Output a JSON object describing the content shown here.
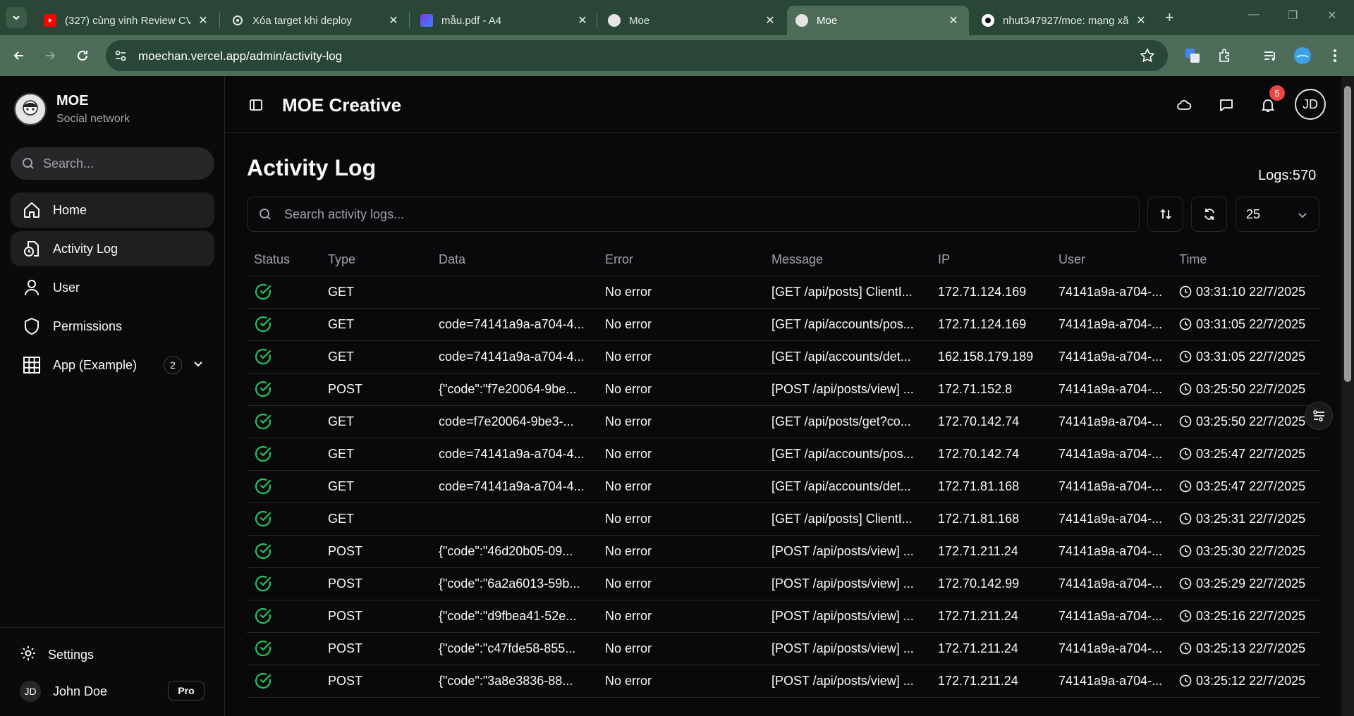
{
  "browser": {
    "tabs": [
      {
        "title": "(327) cùng vinh Review CV"
      },
      {
        "title": "Xóa target khi deploy"
      },
      {
        "title": "mẫu.pdf - A4"
      },
      {
        "title": "Moe"
      },
      {
        "title": "Moe"
      },
      {
        "title": "nhut347927/moe: mạng xã"
      }
    ],
    "url": "moechan.vercel.app/admin/activity-log"
  },
  "sidebar": {
    "brand_name": "MOE",
    "brand_sub": "Social network",
    "search_placeholder": "Search...",
    "items": [
      {
        "label": "Home"
      },
      {
        "label": "Activity Log"
      },
      {
        "label": "User"
      },
      {
        "label": "Permissions"
      },
      {
        "label": "App (Example)",
        "badge": "2"
      }
    ],
    "settings_label": "Settings",
    "user_initials": "JD",
    "user_name": "John Doe",
    "user_plan": "Pro"
  },
  "topbar": {
    "title": "MOE Creative",
    "notifications": "5",
    "avatar_initials": "JD"
  },
  "main": {
    "page_title": "Activity Log",
    "logs_count": "Logs:570",
    "search_placeholder": "Search activity logs...",
    "page_size": "25",
    "columns": [
      "Status",
      "Type",
      "Data",
      "Error",
      "Message",
      "IP",
      "User",
      "Time"
    ],
    "rows": [
      {
        "type": "GET",
        "data": "",
        "error": "No error",
        "message": "[GET /api/posts] ClientI...",
        "ip": "172.71.124.169",
        "user": "74141a9a-a704-...",
        "time": "03:31:10 22/7/2025"
      },
      {
        "type": "GET",
        "data": "code=74141a9a-a704-4...",
        "error": "No error",
        "message": "[GET /api/accounts/pos...",
        "ip": "172.71.124.169",
        "user": "74141a9a-a704-...",
        "time": "03:31:05 22/7/2025"
      },
      {
        "type": "GET",
        "data": "code=74141a9a-a704-4...",
        "error": "No error",
        "message": "[GET /api/accounts/det...",
        "ip": "162.158.179.189",
        "user": "74141a9a-a704-...",
        "time": "03:31:05 22/7/2025"
      },
      {
        "type": "POST",
        "data": "{\"code\":\"f7e20064-9be...",
        "error": "No error",
        "message": "[POST /api/posts/view] ...",
        "ip": "172.71.152.8",
        "user": "74141a9a-a704-...",
        "time": "03:25:50 22/7/2025"
      },
      {
        "type": "GET",
        "data": "code=f7e20064-9be3-...",
        "error": "No error",
        "message": "[GET /api/posts/get?co...",
        "ip": "172.70.142.74",
        "user": "74141a9a-a704-...",
        "time": "03:25:50 22/7/2025"
      },
      {
        "type": "GET",
        "data": "code=74141a9a-a704-4...",
        "error": "No error",
        "message": "[GET /api/accounts/pos...",
        "ip": "172.70.142.74",
        "user": "74141a9a-a704-...",
        "time": "03:25:47 22/7/2025"
      },
      {
        "type": "GET",
        "data": "code=74141a9a-a704-4...",
        "error": "No error",
        "message": "[GET /api/accounts/det...",
        "ip": "172.71.81.168",
        "user": "74141a9a-a704-...",
        "time": "03:25:47 22/7/2025"
      },
      {
        "type": "GET",
        "data": "",
        "error": "No error",
        "message": "[GET /api/posts] ClientI...",
        "ip": "172.71.81.168",
        "user": "74141a9a-a704-...",
        "time": "03:25:31 22/7/2025"
      },
      {
        "type": "POST",
        "data": "{\"code\":\"46d20b05-09...",
        "error": "No error",
        "message": "[POST /api/posts/view] ...",
        "ip": "172.71.211.24",
        "user": "74141a9a-a704-...",
        "time": "03:25:30 22/7/2025"
      },
      {
        "type": "POST",
        "data": "{\"code\":\"6a2a6013-59b...",
        "error": "No error",
        "message": "[POST /api/posts/view] ...",
        "ip": "172.70.142.99",
        "user": "74141a9a-a704-...",
        "time": "03:25:29 22/7/2025"
      },
      {
        "type": "POST",
        "data": "{\"code\":\"d9fbea41-52e...",
        "error": "No error",
        "message": "[POST /api/posts/view] ...",
        "ip": "172.71.211.24",
        "user": "74141a9a-a704-...",
        "time": "03:25:16 22/7/2025"
      },
      {
        "type": "POST",
        "data": "{\"code\":\"c47fde58-855...",
        "error": "No error",
        "message": "[POST /api/posts/view] ...",
        "ip": "172.71.211.24",
        "user": "74141a9a-a704-...",
        "time": "03:25:13 22/7/2025"
      },
      {
        "type": "POST",
        "data": "{\"code\":\"3a8e3836-88...",
        "error": "No error",
        "message": "[POST /api/posts/view] ...",
        "ip": "172.71.211.24",
        "user": "74141a9a-a704-...",
        "time": "03:25:12 22/7/2025"
      }
    ]
  },
  "colors": {
    "success": "#22c55e",
    "badge": "#ef4444",
    "tab_active": "#4d6d5a",
    "tab_bar": "#2a4636"
  }
}
